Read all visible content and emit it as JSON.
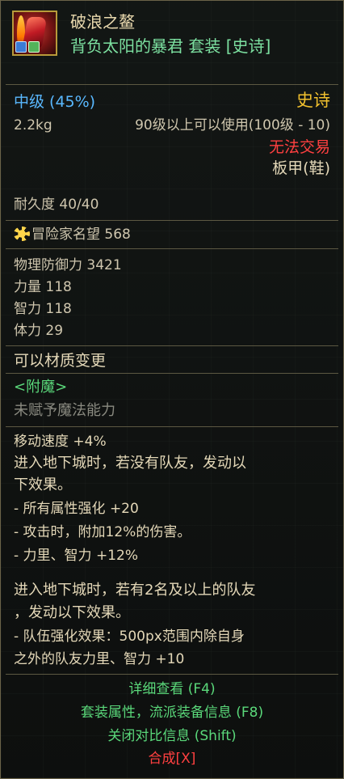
{
  "item": {
    "name": "破浪之鳌",
    "set_line": "背负太阳的暴君 套装 [史诗]",
    "grade": "中级 (45%)",
    "rarity": "史诗",
    "weight": "2.2kg",
    "level_req": "90级以上可以使用(100级 - 10)",
    "trade": "无法交易",
    "type": "板甲(鞋)",
    "durability": "耐久度 40/40",
    "fame": "冒险家名望 568"
  },
  "stats": {
    "phys_def": "物理防御力 3421",
    "str": "力量 118",
    "int": "智力 118",
    "vit": "体力 29"
  },
  "material": "可以材质变更",
  "enchant": {
    "header": "<附魔>",
    "value": "未赋予魔法能力"
  },
  "effects": [
    "移动速度 +4%",
    "进入地下城时，若没有队友，发动以",
    "下效果。",
    "- 所有属性强化 +20",
    "- 攻击时，附加12%的伤害。",
    "- 力里、智力 +12%",
    "",
    "进入地下城时，若有2名及以上的队友",
    "，发动以下效果。",
    "- 队伍强化效果：500px范围内除自身",
    "之外的队友力里、智力 +10"
  ],
  "actions": {
    "detail": "详细查看 (F4)",
    "set_info": "套装属性，流派装备信息 (F8)",
    "compare": "关闭对比信息 (Shift)",
    "craft": "合成[X]"
  },
  "colors": {
    "name": "#e9d9ae",
    "set": "#7ce0a0",
    "grade": "#59b8ff",
    "rarity": "#f2c12e",
    "untradeable": "#ff4040",
    "enchant_header": "#5ad87a",
    "actions": "#5ad87a",
    "craft": "#ff4040"
  }
}
